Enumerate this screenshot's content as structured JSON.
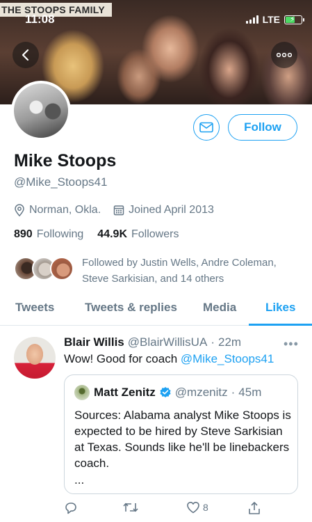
{
  "status_bar": {
    "time": "11:08",
    "network": "LTE"
  },
  "banner": {
    "label": "THE STOOPS FAMILY"
  },
  "profile": {
    "display_name": "Mike Stoops",
    "handle": "@Mike_Stoops41",
    "location": "Norman, Okla.",
    "joined": "Joined April 2013",
    "following_count": "890",
    "following_label": "Following",
    "followers_count": "44.9K",
    "followers_label": "Followers",
    "followed_by": "Followed by Justin Wells, Andre Coleman, Steve Sarkisian, and 14 others"
  },
  "actions": {
    "follow_label": "Follow"
  },
  "tabs": [
    {
      "label": "Tweets"
    },
    {
      "label": "Tweets & replies"
    },
    {
      "label": "Media"
    },
    {
      "label": "Likes"
    }
  ],
  "tweet": {
    "name": "Blair Willis",
    "handle": "@BlairWillisUA",
    "separator": "·",
    "time": "22m",
    "text": "Wow! Good for coach",
    "mention": "@Mike_Stoops41",
    "like_count": "8",
    "quote": {
      "name": "Matt Zenitz",
      "handle": "@mzenitz",
      "separator": "·",
      "time": "45m",
      "text": "Sources: Alabama analyst Mike Stoops is expected to be hired by Steve Sarkisian at Texas. Sounds like he'll be linebackers coach.",
      "more": "..."
    }
  },
  "colors": {
    "accent": "#1da1f2",
    "muted": "#657786",
    "text": "#14171a"
  }
}
